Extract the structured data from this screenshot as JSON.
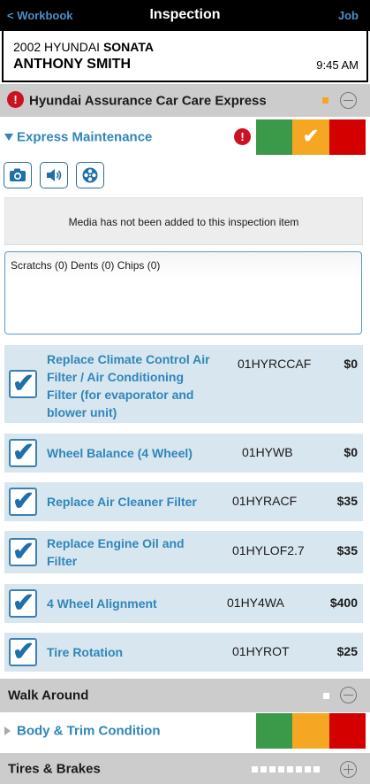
{
  "navbar": {
    "back": "< Workbook",
    "title": "Inspection",
    "job": "Job"
  },
  "vehicle": {
    "year_make": "2002 HYUNDAI",
    "model": "SONATA",
    "customer": "ANTHONY SMITH",
    "time": "9:45 AM"
  },
  "sections": {
    "care": {
      "title": "Hyundai Assurance Car Care Express",
      "alert": "!",
      "indicator_color": "#f5a623"
    },
    "walk": {
      "title": "Walk Around",
      "indicator_color": "#ffffff"
    },
    "tires": {
      "title": "Tires & Brakes"
    }
  },
  "express": {
    "label": "Express Maintenance",
    "alert": "!",
    "selected_status": "yellow",
    "check": "✔"
  },
  "media_buttons": [
    "camera-icon",
    "speaker-icon",
    "film-reel-icon"
  ],
  "media_note": "Media has not been added to this inspection item",
  "notes_text": "Scratchs (0) Dents (0) Chips (0)",
  "items": [
    {
      "name_lines": [
        "Replace Climate Control Air",
        "Filter / Air Conditioning",
        "Filter (for evaporator and",
        "blower unit)"
      ],
      "code": "01HYRCCAF",
      "price": "$0",
      "checked": true
    },
    {
      "name_lines": [
        "Wheel Balance (4 Wheel)"
      ],
      "code": "01HYWB",
      "price": "$0",
      "checked": true
    },
    {
      "name_lines": [
        "Replace Air Cleaner Filter"
      ],
      "code": "01HYRACF",
      "price": "$35",
      "checked": true
    },
    {
      "name_lines": [
        "Replace Engine Oil and",
        "Filter"
      ],
      "code": "01HYLOF2.7",
      "price": "$35",
      "checked": true
    },
    {
      "name_lines": [
        "4 Wheel Alignment"
      ],
      "code": "01HY4WA",
      "price": "$400",
      "checked": true
    },
    {
      "name_lines": [
        "Tire Rotation"
      ],
      "code": "01HYROT",
      "price": "$25",
      "checked": true
    }
  ],
  "check_glyph": "✔",
  "body_trim": {
    "label": "Body & Trim Condition"
  },
  "colors": {
    "green": "#3a9a4a",
    "yellow": "#f5a623",
    "red": "#d40000",
    "link_blue": "#2f86b8"
  }
}
